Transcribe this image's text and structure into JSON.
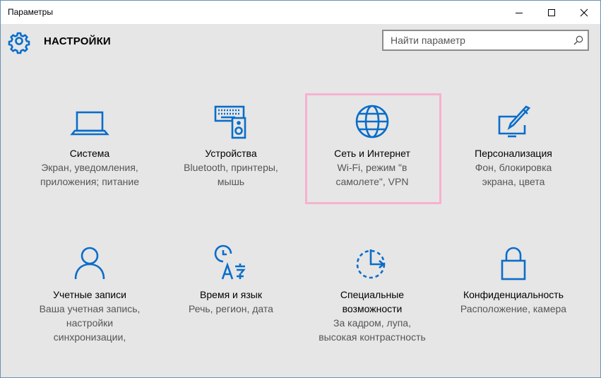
{
  "window": {
    "title": "Параметры",
    "controls": [
      "minimize",
      "maximize",
      "close"
    ]
  },
  "header": {
    "title": "НАСТРОЙКИ",
    "icon": "gear-icon"
  },
  "search": {
    "placeholder": "Найти параметр",
    "value": ""
  },
  "accent_color": "#0a6dc9",
  "highlight_color": "#f7b1cf",
  "tiles": [
    {
      "name": "Система",
      "desc": [
        "Экран, уведомления,",
        "приложения; питание"
      ],
      "icon": "laptop-icon"
    },
    {
      "name": "Устройства",
      "desc": [
        "Bluetooth, принтеры,",
        "мышь"
      ],
      "icon": "keyboard-speaker-icon"
    },
    {
      "name": "Сеть и Интернет",
      "desc": [
        "Wi-Fi, режим \"в",
        "самолете\", VPN"
      ],
      "icon": "globe-icon",
      "highlighted": true
    },
    {
      "name": "Персонализация",
      "desc": [
        "Фон, блокировка",
        "экрана, цвета"
      ],
      "icon": "paint-monitor-icon"
    },
    {
      "name": "Учетные записи",
      "desc": [
        "Ваша учетная запись,",
        "настройки",
        "синхронизации,"
      ],
      "icon": "person-icon"
    },
    {
      "name": "Время и язык",
      "desc": [
        "Речь, регион, дата"
      ],
      "icon": "clock-language-icon"
    },
    {
      "name": "Специальные возможности",
      "name_lines": [
        "Специальные",
        "возможности"
      ],
      "desc": [
        "За кадром, лупа,",
        "высокая контрастность"
      ],
      "icon": "ease-of-access-icon"
    },
    {
      "name": "Конфиденциальность",
      "desc": [
        "Расположение, камера"
      ],
      "icon": "lock-icon"
    }
  ]
}
